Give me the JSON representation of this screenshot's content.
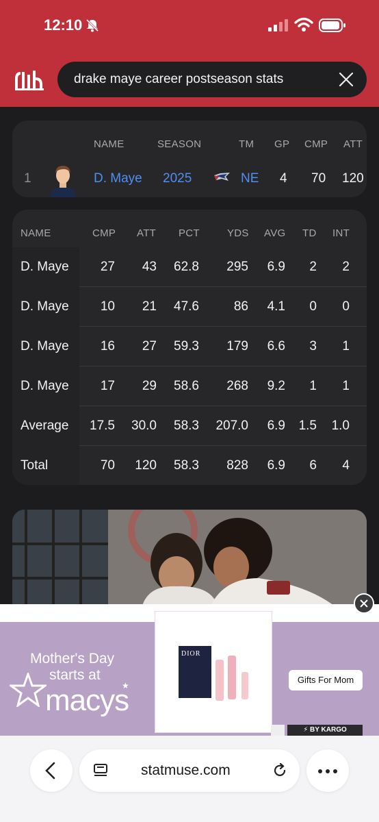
{
  "status_bar": {
    "time": "12:10"
  },
  "search": {
    "query": "drake maye career postseason stats"
  },
  "summary": {
    "headers": [
      "NAME",
      "SEASON",
      "TM",
      "GP",
      "CMP",
      "ATT"
    ],
    "rank": "1",
    "name": "D. Maye",
    "season": "2025",
    "team": "NE",
    "gp": "4",
    "cmp": "70",
    "att": "120"
  },
  "games_table": {
    "headers": [
      "NAME",
      "CMP",
      "ATT",
      "PCT",
      "YDS",
      "AVG",
      "TD",
      "INT"
    ],
    "rows": [
      [
        "D. Maye",
        "27",
        "43",
        "62.8",
        "295",
        "6.9",
        "2",
        "2"
      ],
      [
        "D. Maye",
        "10",
        "21",
        "47.6",
        "86",
        "4.1",
        "0",
        "0"
      ],
      [
        "D. Maye",
        "16",
        "27",
        "59.3",
        "179",
        "6.6",
        "3",
        "1"
      ],
      [
        "D. Maye",
        "17",
        "29",
        "58.6",
        "268",
        "9.2",
        "1",
        "1"
      ],
      [
        "Average",
        "17.5",
        "30.0",
        "58.3",
        "207.0",
        "6.9",
        "1.5",
        "1.0"
      ],
      [
        "Total",
        "70",
        "120",
        "58.3",
        "828",
        "6.9",
        "6",
        "4"
      ]
    ]
  },
  "ad": {
    "line1": "Mother's Day",
    "line2": "starts at",
    "brand": "macys",
    "cta": "Gifts For Mom",
    "badge": "⚡ BY KARGO",
    "product_brand": "DIOR"
  },
  "browser": {
    "url": "statmuse.com"
  },
  "colors": {
    "header_red": "#c0303a",
    "link_blue": "#4e8ff0",
    "card_bg": "#27272a"
  }
}
